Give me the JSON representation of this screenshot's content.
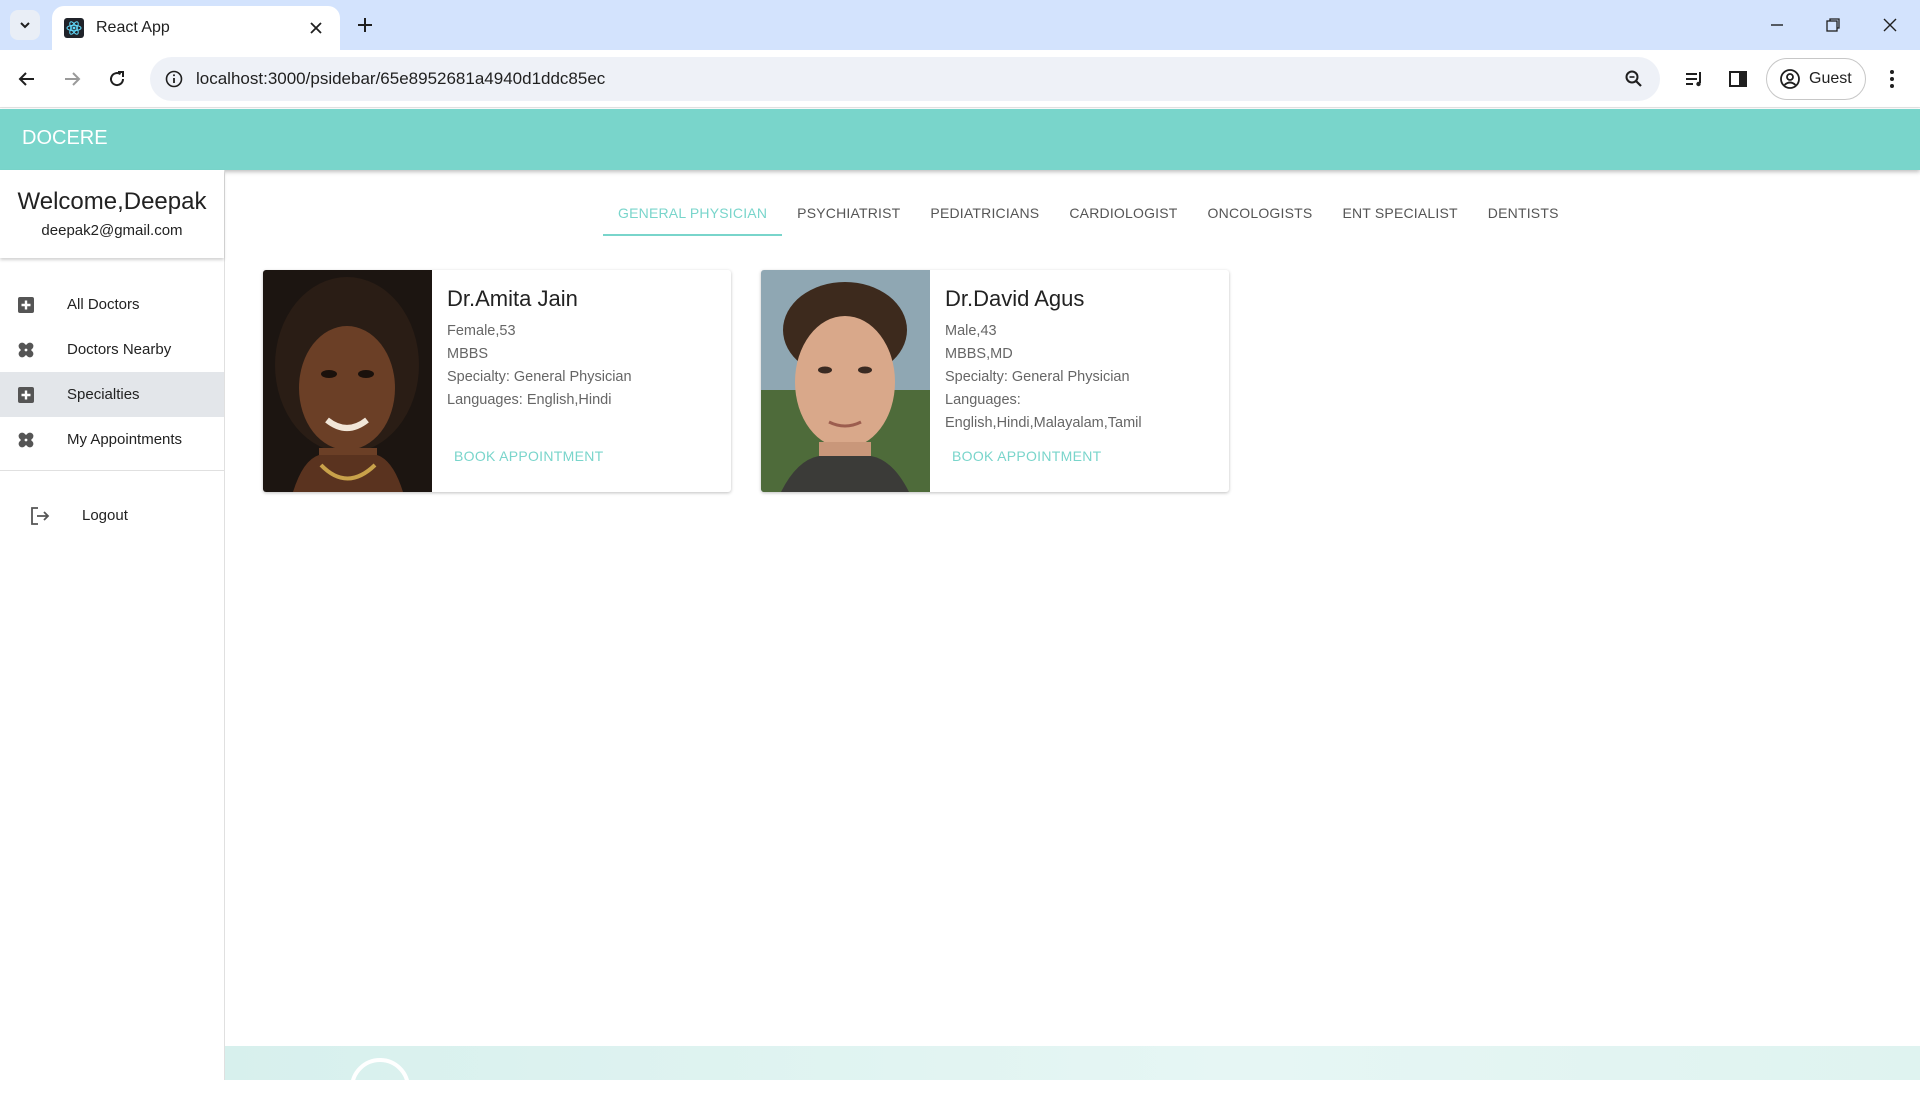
{
  "browser": {
    "tab_title": "React App",
    "url": "localhost:3000/psidebar/65e8952681a4940d1ddc85ec",
    "profile_label": "Guest"
  },
  "app": {
    "brand": "DOCERE",
    "accent_color": "#79d5cb"
  },
  "sidebar": {
    "welcome": "Welcome,Deepak",
    "email": "deepak2@gmail.com",
    "items": [
      {
        "label": "All Doctors",
        "icon": "plus-box-icon"
      },
      {
        "label": "Doctors Nearby",
        "icon": "bandage-icon"
      },
      {
        "label": "Specialties",
        "icon": "plus-box-icon"
      },
      {
        "label": "My Appointments",
        "icon": "bandage-icon"
      }
    ],
    "logout": "Logout"
  },
  "tabs": [
    "GENERAL PHYSICIAN",
    "PSYCHIATRIST",
    "PEDIATRICIANS",
    "CARDIOLOGIST",
    "ONCOLOGISTS",
    "ENT SPECIALIST",
    "DENTISTS"
  ],
  "doctors": [
    {
      "name": "Dr.Amita Jain",
      "gender_age": "Female,53",
      "degree": "MBBS",
      "specialty": "Specialty: General Physician",
      "languages_label": "Languages:",
      "languages": "English,Hindi",
      "book": "BOOK APPOINTMENT"
    },
    {
      "name": "Dr.David Agus",
      "gender_age": "Male,43",
      "degree": "MBBS,MD",
      "specialty": "Specialty: General Physician",
      "languages_label": "Languages:",
      "languages": "English,Hindi,Malayalam,Tamil",
      "book": "BOOK APPOINTMENT"
    }
  ]
}
